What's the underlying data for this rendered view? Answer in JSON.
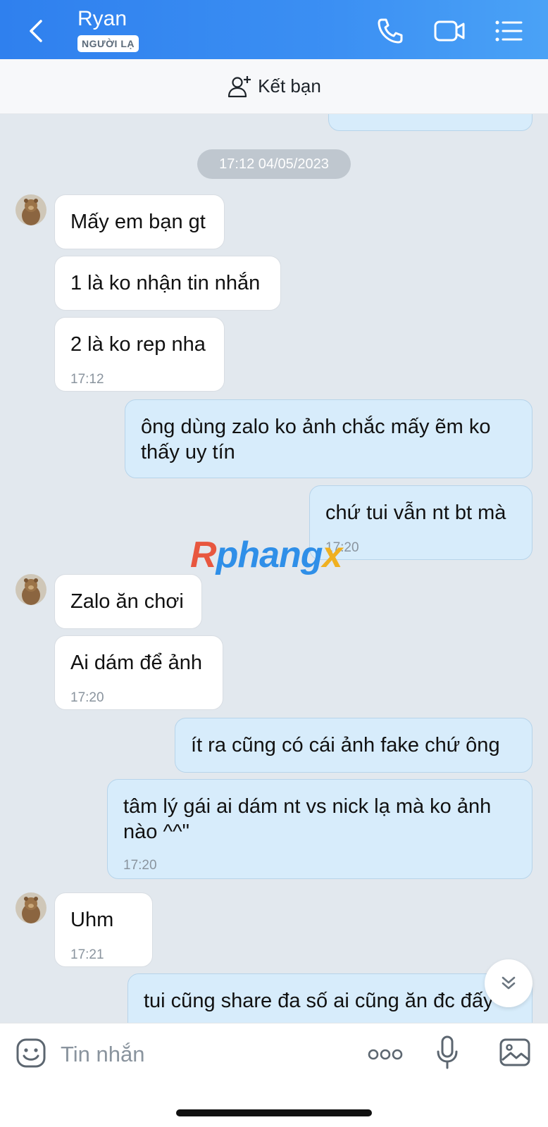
{
  "header": {
    "contact_name": "Ryan",
    "badge": "NGƯỜI LẠ",
    "icons": [
      "back-chevron-icon",
      "phone-icon",
      "video-call-icon",
      "menu-list-icon"
    ]
  },
  "add_friend": {
    "label": "Kết bạn",
    "icon": "add-person-icon"
  },
  "date_separator": "17:12 04/05/2023",
  "messages": [
    {
      "text": "Mấy em bạn gt"
    },
    {
      "text": "1 là ko nhận tin nhắn"
    },
    {
      "text": "2 là ko rep nha",
      "time": "17:12"
    },
    {
      "text": "ông dùng zalo ko ảnh chắc mấy ẽm ko thấy uy tín"
    },
    {
      "text": "chứ tui vẫn nt bt mà",
      "time": "17:20"
    },
    {
      "text": "Zalo ăn chơi"
    },
    {
      "text": "Ai dám để ảnh",
      "time": "17:20"
    },
    {
      "text": "ít ra cũng có cái ảnh fake chứ ông"
    },
    {
      "text": "tâm lý gái ai dám nt vs nick lạ mà ko ảnh nào ^^\"",
      "time": "17:20"
    },
    {
      "text": "Uhm",
      "time": "17:21"
    },
    {
      "text": "tui cũng share đa số ai cũng ăn đc đấy"
    }
  ],
  "watermark": {
    "r": "R",
    "rest": "phang",
    "x": "x"
  },
  "composer": {
    "placeholder": "Tin nhắn"
  },
  "colors": {
    "header_blue": "#2f80ee",
    "outgoing_bubble": "#d7ecfb",
    "incoming_bubble": "#ffffff",
    "chat_background": "#e2e8ee"
  }
}
